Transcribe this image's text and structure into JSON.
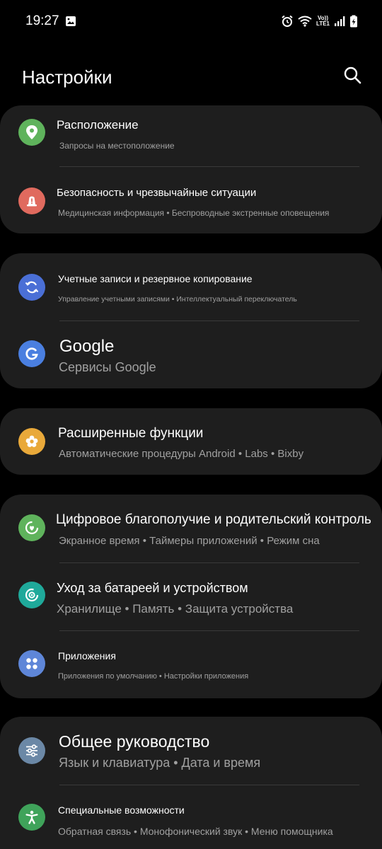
{
  "status_bar": {
    "time": "19:27",
    "left_icons": [
      "image-icon"
    ],
    "right_icons": [
      "alarm-icon",
      "wifi-icon",
      "volte-lte-icon",
      "signal-icon",
      "battery-charging-icon"
    ],
    "volte_label": "Vo))",
    "lte_label": "LTE1"
  },
  "header": {
    "title": "Настройки",
    "search_icon": "search-icon"
  },
  "sections": [
    {
      "items": [
        {
          "title": "Расположение",
          "subtitle": "Запросы на местоположение",
          "icon": "location-pin-icon",
          "color": "#5fb35c"
        },
        {
          "title": "Безопасность и чрезвычайные ситуации",
          "subtitle": "Медицинская информация • Беспроводные экстренные оповещения",
          "icon": "emergency-alert-icon",
          "color": "#e06a5e"
        }
      ]
    },
    {
      "items": [
        {
          "title": "Учетные записи и резервное копирование",
          "subtitle": "Управление учетными записями • Интеллектуальный переключатель",
          "icon": "sync-icon",
          "color": "#4a6fd6"
        },
        {
          "title": "Google",
          "subtitle": "Сервисы Google",
          "icon": "google-g-icon",
          "color": "#4a7fe0"
        }
      ]
    },
    {
      "items": [
        {
          "title": "Расширенные функции",
          "subtitle": "Автоматические процедуры Android • Labs • Bixby",
          "icon": "puzzle-star-icon",
          "color": "#e9a93a"
        }
      ]
    },
    {
      "items": [
        {
          "title": "Цифровое благополучие и родительский контроль",
          "subtitle": "Экранное время • Таймеры приложений • Режим сна",
          "icon": "wellbeing-heart-icon",
          "color": "#5fb35c"
        },
        {
          "title": "Уход за батареей и устройством",
          "subtitle": "Хранилище • Память • Защита устройства",
          "icon": "device-care-icon",
          "color": "#1fa99a"
        },
        {
          "title": "Приложения",
          "subtitle": "Приложения по умолчанию • Настройки приложения",
          "icon": "apps-grid-icon",
          "color": "#5e86d8"
        }
      ]
    },
    {
      "items": [
        {
          "title": "Общее руководство",
          "subtitle": "Язык и клавиатура • Дата и время",
          "icon": "sliders-icon",
          "color": "#6b88a6"
        },
        {
          "title": "Специальные возможности",
          "subtitle": "Обратная связь • Монофонический звук • Меню помощника",
          "icon": "accessibility-icon",
          "color": "#3fa35a"
        }
      ]
    }
  ]
}
